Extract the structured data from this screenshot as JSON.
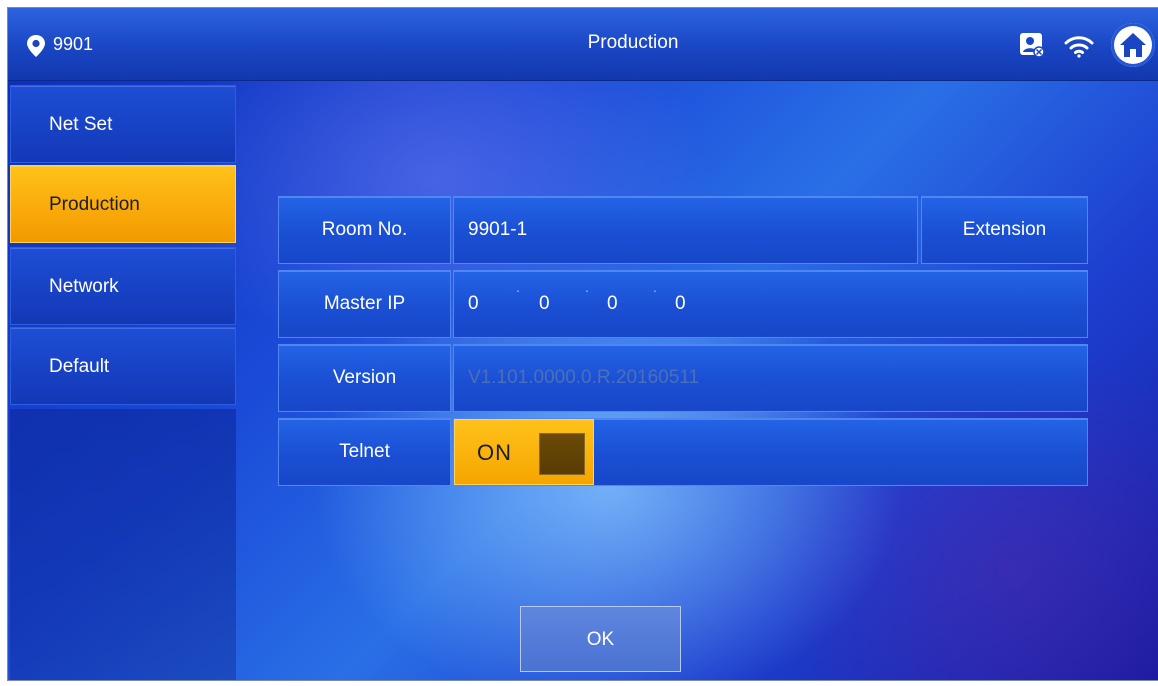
{
  "header": {
    "location": "9901",
    "title": "Production"
  },
  "sidebar": {
    "items": [
      {
        "label": "Net Set",
        "active": false
      },
      {
        "label": "Production",
        "active": true
      },
      {
        "label": "Network",
        "active": false
      },
      {
        "label": "Default",
        "active": false
      }
    ]
  },
  "form": {
    "room_no": {
      "label": "Room No.",
      "value": "9901-1",
      "button": "Extension"
    },
    "master_ip": {
      "label": "Master IP",
      "octets": [
        "0",
        "0",
        "0",
        "0"
      ],
      "separator": "."
    },
    "version": {
      "label": "Version",
      "value": "V1.101.0000.0.R.20160511"
    },
    "telnet": {
      "label": "Telnet",
      "state": "ON"
    }
  },
  "footer": {
    "ok_label": "OK"
  },
  "icons": [
    "location-pin-icon",
    "card-status-icon",
    "wifi-icon",
    "home-icon"
  ],
  "colors": {
    "accent": "#f9a90a",
    "panel": "#1a4fd4",
    "background": "#1a4bd8"
  }
}
